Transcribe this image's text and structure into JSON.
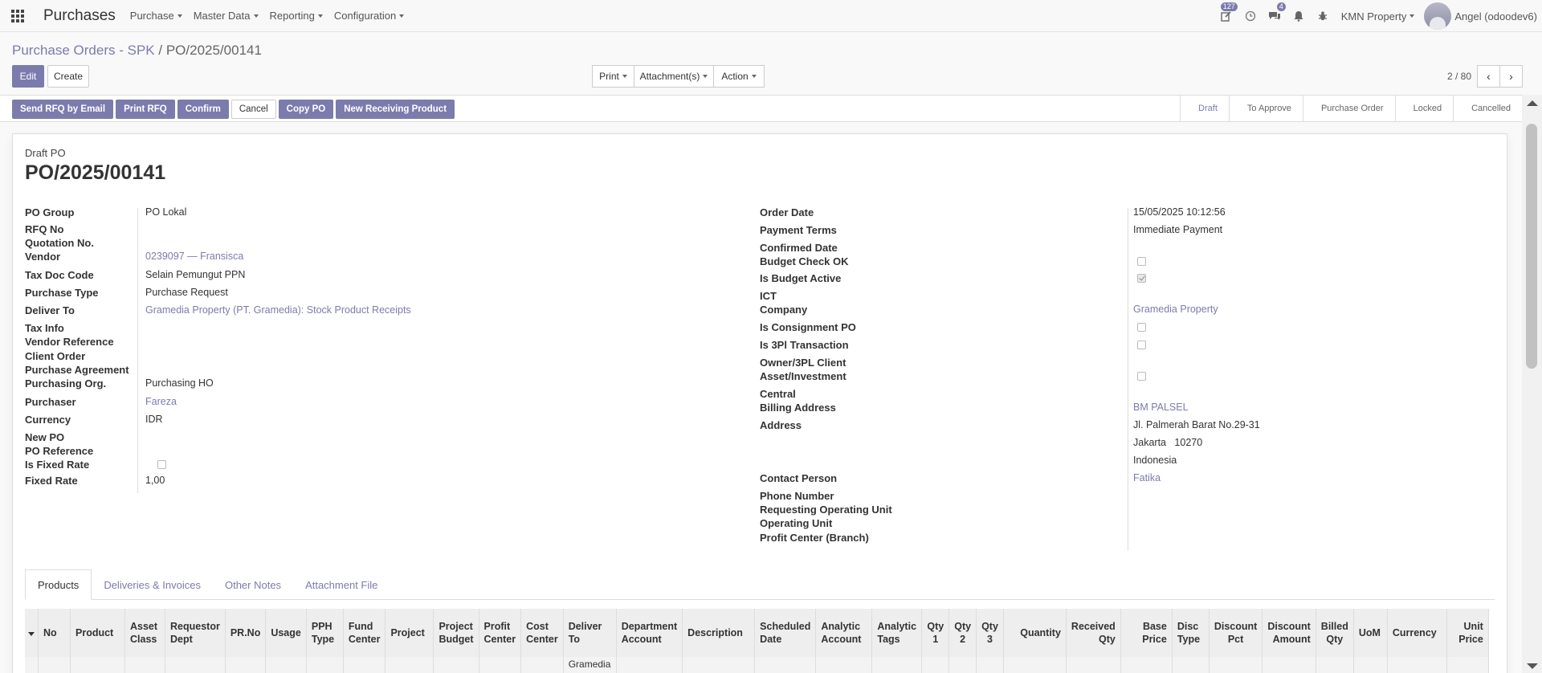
{
  "app": {
    "title": "Purchases"
  },
  "menu": [
    {
      "label": "Purchase"
    },
    {
      "label": "Master Data"
    },
    {
      "label": "Reporting"
    },
    {
      "label": "Configuration"
    }
  ],
  "systray": {
    "activity_count": "127",
    "messages_count": "4",
    "company": "KMN Property",
    "user": "Angel (odoodev6)"
  },
  "breadcrumb": {
    "parent": "Purchase Orders - SPK",
    "separator": "/",
    "current": "PO/2025/00141"
  },
  "control": {
    "edit": "Edit",
    "create": "Create",
    "print": "Print",
    "attachments": "Attachment(s)",
    "action": "Action"
  },
  "pager": {
    "value": "2 / 80"
  },
  "header_buttons": {
    "send_rfq": "Send RFQ by Email",
    "print_rfq": "Print RFQ",
    "confirm": "Confirm",
    "cancel": "Cancel",
    "copy_po": "Copy PO",
    "new_receiving": "New Receiving Product"
  },
  "status_steps": [
    "Draft",
    "To Approve",
    "Purchase Order",
    "Locked",
    "Cancelled"
  ],
  "status_active": "Draft",
  "form": {
    "label": "Draft PO",
    "name": "PO/2025/00141",
    "left": {
      "po_group": {
        "label": "PO Group",
        "value": "PO Lokal"
      },
      "rfq_no": {
        "label": "RFQ No"
      },
      "quotation_no": {
        "label": "Quotation No."
      },
      "vendor": {
        "label": "Vendor",
        "value": "0239097 — Fransisca"
      },
      "tax_doc_code": {
        "label": "Tax Doc Code",
        "value": "Selain Pemungut PPN"
      },
      "purchase_type": {
        "label": "Purchase Type",
        "value": "Purchase Request"
      },
      "deliver_to": {
        "label": "Deliver To",
        "value": "Gramedia Property (PT. Gramedia): Stock Product Receipts"
      },
      "tax_info": {
        "label": "Tax Info"
      },
      "vendor_reference": {
        "label": "Vendor Reference"
      },
      "client_order": {
        "label": "Client Order"
      },
      "purchase_agreement": {
        "label": "Purchase Agreement"
      },
      "purchasing_org": {
        "label": "Purchasing Org.",
        "value": "Purchasing HO"
      },
      "purchaser": {
        "label": "Purchaser",
        "value": "Fareza"
      },
      "currency": {
        "label": "Currency",
        "value": "IDR"
      },
      "new_po": {
        "label": "New PO"
      },
      "po_reference": {
        "label": "PO Reference"
      },
      "is_fixed_rate": {
        "label": "Is Fixed Rate"
      },
      "fixed_rate": {
        "label": "Fixed Rate",
        "value": "1,00"
      }
    },
    "right": {
      "order_date": {
        "label": "Order Date",
        "value": "15/05/2025 10:12:56"
      },
      "payment_terms": {
        "label": "Payment Terms",
        "value": "Immediate Payment"
      },
      "confirmed_date": {
        "label": "Confirmed Date"
      },
      "budget_check_ok": {
        "label": "Budget Check OK"
      },
      "is_budget_active": {
        "label": "Is Budget Active"
      },
      "ict": {
        "label": "ICT"
      },
      "company": {
        "label": "Company",
        "value": "Gramedia Property"
      },
      "is_consignment_po": {
        "label": "Is Consignment PO"
      },
      "is_3pl": {
        "label": "Is 3Pl Transaction"
      },
      "owner_3pl": {
        "label": "Owner/3PL Client"
      },
      "asset_investment": {
        "label": "Asset/Investment"
      },
      "central": {
        "label": "Central"
      },
      "billing_address": {
        "label": "Billing Address",
        "value": "BM PALSEL"
      },
      "address": {
        "label": "Address",
        "line1": "Jl. Palmerah Barat No.29-31",
        "line2": "Jakarta   10270",
        "line3": "Indonesia"
      },
      "contact_person": {
        "label": "Contact Person",
        "value": "Fatika"
      },
      "phone_number": {
        "label": "Phone Number"
      },
      "requesting_ou": {
        "label": "Requesting Operating Unit"
      },
      "operating_unit": {
        "label": "Operating Unit"
      },
      "profit_center": {
        "label": "Profit Center (Branch)"
      }
    }
  },
  "tabs": [
    "Products",
    "Deliveries & Invoices",
    "Other Notes",
    "Attachment File"
  ],
  "table": {
    "columns": [
      {
        "l1": "No",
        "l2": ""
      },
      {
        "l1": "Product",
        "l2": ""
      },
      {
        "l1": "Asset",
        "l2": "Class"
      },
      {
        "l1": "Requestor",
        "l2": "Dept"
      },
      {
        "l1": "PR.No",
        "l2": ""
      },
      {
        "l1": "Usage",
        "l2": ""
      },
      {
        "l1": "PPH",
        "l2": "Type"
      },
      {
        "l1": "Fund",
        "l2": "Center"
      },
      {
        "l1": "Project",
        "l2": ""
      },
      {
        "l1": "Project",
        "l2": "Budget"
      },
      {
        "l1": "Profit",
        "l2": "Center"
      },
      {
        "l1": "Cost",
        "l2": "Center"
      },
      {
        "l1": "Deliver",
        "l2": "To"
      },
      {
        "l1": "Department",
        "l2": "Account"
      },
      {
        "l1": "Description",
        "l2": ""
      },
      {
        "l1": "Scheduled",
        "l2": "Date"
      },
      {
        "l1": "Analytic",
        "l2": "Account"
      },
      {
        "l1": "Analytic",
        "l2": "Tags"
      },
      {
        "l1": "Qty",
        "l2": "1"
      },
      {
        "l1": "Qty",
        "l2": "2"
      },
      {
        "l1": "Qty",
        "l2": "3"
      },
      {
        "l1": "Quantity",
        "l2": ""
      },
      {
        "l1": "Received",
        "l2": "Qty"
      },
      {
        "l1": "Base",
        "l2": "Price"
      },
      {
        "l1": "Disc",
        "l2": "Type"
      },
      {
        "l1": "Discount",
        "l2": "Pct"
      },
      {
        "l1": "Discount",
        "l2": "Amount"
      },
      {
        "l1": "Billed",
        "l2": "Qty"
      },
      {
        "l1": "UoM",
        "l2": ""
      },
      {
        "l1": "Currency",
        "l2": ""
      },
      {
        "l1": "Unit",
        "l2": "Price"
      }
    ],
    "first_row_deliver_to": "Gramedia"
  },
  "colors": {
    "accent": "#7c7bad",
    "text": "#4c4c4c",
    "border": "#dddddd"
  }
}
